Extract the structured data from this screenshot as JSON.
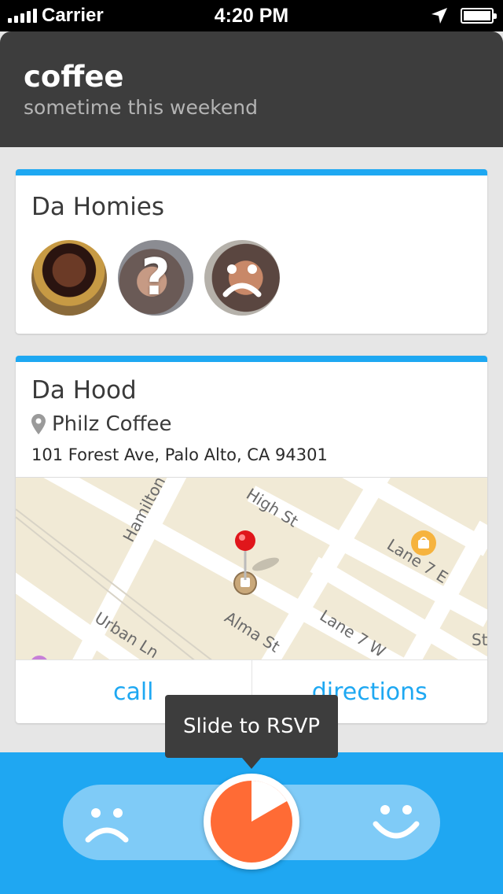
{
  "status_bar": {
    "carrier": "Carrier",
    "time": "4:20 PM"
  },
  "event": {
    "title": "coffee",
    "time": "sometime this weekend"
  },
  "group": {
    "name": "Da Homies",
    "members": [
      {
        "status_icon": "none"
      },
      {
        "status_icon": "question-mark",
        "glyph": "?"
      },
      {
        "status_icon": "sad-face"
      }
    ]
  },
  "place": {
    "section_title": "Da Hood",
    "name": "Philz Coffee",
    "address": "101 Forest Ave, Palo Alto, CA 94301",
    "map_labels": {
      "hamilton": "Hamilton",
      "high_st": "High St",
      "lane7e": "Lane 7 E",
      "urban_ln": "Urban Ln",
      "alma_st": "Alma St",
      "lane7w": "Lane 7 W",
      "st": "St"
    },
    "actions": {
      "call": "call",
      "directions": "directions"
    }
  },
  "rsvp": {
    "tooltip": "Slide to RSVP"
  },
  "colors": {
    "accent": "#1ea8f2",
    "header": "#3d3d3d",
    "rsvp_orange": "#ff6b35"
  }
}
